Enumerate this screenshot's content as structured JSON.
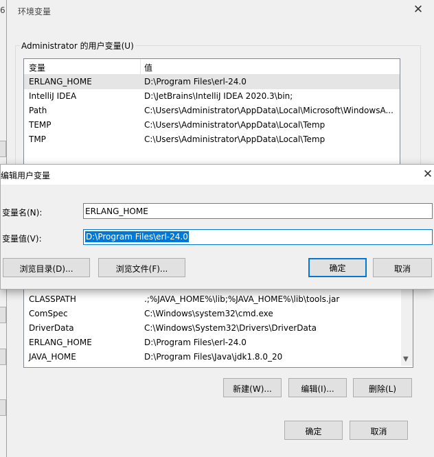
{
  "env_window": {
    "title": "环境变量",
    "user_vars_label": "Administrator 的用户变量(U)",
    "columns": {
      "name": "变量",
      "value": "值"
    },
    "user_vars": [
      {
        "name": "ERLANG_HOME",
        "value": "D:\\Program Files\\erl-24.0"
      },
      {
        "name": "IntelliJ IDEA",
        "value": "D:\\JetBrains\\IntelliJ IDEA 2020.3\\bin;"
      },
      {
        "name": "Path",
        "value": "C:\\Users\\Administrator\\AppData\\Local\\Microsoft\\WindowsA..."
      },
      {
        "name": "TEMP",
        "value": "C:\\Users\\Administrator\\AppData\\Local\\Temp"
      },
      {
        "name": "TMP",
        "value": "C:\\Users\\Administrator\\AppData\\Local\\Temp"
      }
    ],
    "system_vars": [
      {
        "name": "CLASSPATH",
        "value": ".;%JAVA_HOME%\\lib;%JAVA_HOME%\\lib\\tools.jar"
      },
      {
        "name": "ComSpec",
        "value": "C:\\Windows\\system32\\cmd.exe"
      },
      {
        "name": "DriverData",
        "value": "C:\\Windows\\System32\\Drivers\\DriverData"
      },
      {
        "name": "ERLANG_HOME",
        "value": "D:\\Program Files\\erl-24.0"
      },
      {
        "name": "JAVA_HOME",
        "value": "D:\\Program Files\\Java\\jdk1.8.0_20"
      }
    ],
    "system_buttons": {
      "new": "新建(W)...",
      "edit": "编辑(I)...",
      "delete": "删除(L)"
    },
    "ok": "确定",
    "cancel": "取消"
  },
  "edit_dialog": {
    "title": "编辑用户变量",
    "name_label": "变量名(N):",
    "name_value": "ERLANG_HOME",
    "value_label": "变量值(V):",
    "value_value": "D:\\Program Files\\erl-24.0",
    "browse_dir": "浏览目录(D)...",
    "browse_file": "浏览文件(F)...",
    "ok": "确定",
    "cancel": "取消"
  },
  "behind_window": {
    "title_char": "6"
  },
  "icons": {
    "close": "close-icon",
    "scroll_down": "chevron-down-icon"
  },
  "colors": {
    "accent": "#0078d7",
    "selected_row": "#e5e5e5"
  }
}
